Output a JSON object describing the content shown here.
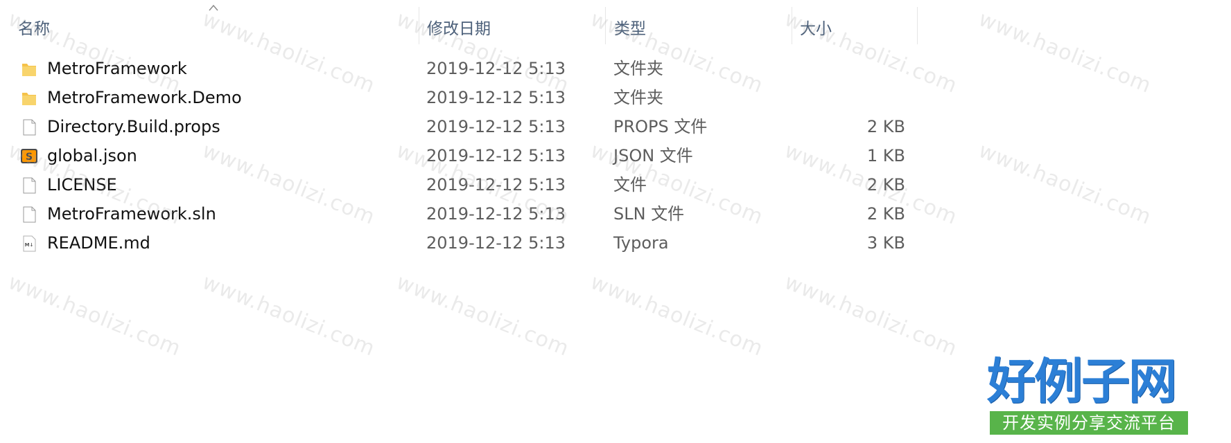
{
  "header": {
    "columns": [
      {
        "label": "名称"
      },
      {
        "label": "修改日期"
      },
      {
        "label": "类型"
      },
      {
        "label": "大小"
      }
    ]
  },
  "files": [
    {
      "name": "MetroFramework",
      "date": "2019-12-12 5:13",
      "type": "文件夹",
      "size": "",
      "icon": "folder-icon"
    },
    {
      "name": "MetroFramework.Demo",
      "date": "2019-12-12 5:13",
      "type": "文件夹",
      "size": "",
      "icon": "folder-icon"
    },
    {
      "name": "Directory.Build.props",
      "date": "2019-12-12 5:13",
      "type": "PROPS 文件",
      "size": "2 KB",
      "icon": "file-icon"
    },
    {
      "name": "global.json",
      "date": "2019-12-12 5:13",
      "type": "JSON 文件",
      "size": "1 KB",
      "icon": "sublime-text-icon"
    },
    {
      "name": "LICENSE",
      "date": "2019-12-12 5:13",
      "type": "文件",
      "size": "2 KB",
      "icon": "file-icon"
    },
    {
      "name": "MetroFramework.sln",
      "date": "2019-12-12 5:13",
      "type": "SLN 文件",
      "size": "2 KB",
      "icon": "file-icon"
    },
    {
      "name": "README.md",
      "date": "2019-12-12 5:13",
      "type": "Typora",
      "size": "3 KB",
      "icon": "markdown-icon"
    }
  ],
  "watermark": {
    "text": "www.haolizi.com",
    "logo_main": "好例子网",
    "logo_sub": "开发实例分享交流平台"
  },
  "colors": {
    "folder": "#f5c249",
    "header_text": "#4c607a",
    "logo_blue": "#2c7fd6",
    "logo_green": "#58b44a"
  }
}
